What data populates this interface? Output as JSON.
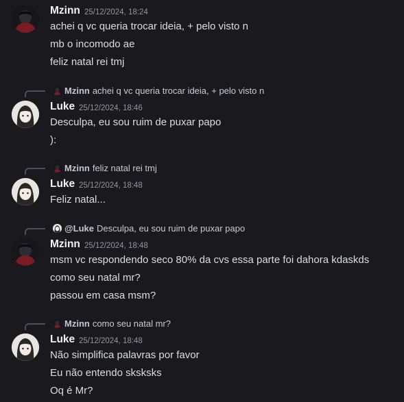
{
  "messages": [
    {
      "author": "Mzinn",
      "timestamp": "25/12/2024, 18:24",
      "lines": [
        "achei q vc queria trocar ideia, + pelo visto n",
        "mb o incomodo ae",
        "feliz natal rei tmj"
      ]
    },
    {
      "reply": {
        "author": "Mzinn",
        "text": "achei q vc queria trocar ideia, + pelo visto n"
      },
      "author": "Luke",
      "timestamp": "25/12/2024, 18:46",
      "lines": [
        "Desculpa, eu sou ruim de puxar papo",
        "):"
      ]
    },
    {
      "reply": {
        "author": "Mzinn",
        "text": "feliz natal rei tmj"
      },
      "author": "Luke",
      "timestamp": "25/12/2024, 18:48",
      "lines": [
        "Feliz natal..."
      ]
    },
    {
      "reply": {
        "author": "@Luke",
        "text": "Desculpa, eu sou ruim de puxar papo"
      },
      "author": "Mzinn",
      "timestamp": "25/12/2024, 18:48",
      "lines": [
        "msm vc respondendo seco 80% da cvs essa parte foi dahora kdaskds",
        "como seu natal mr?",
        "passou em casa msm?"
      ]
    },
    {
      "reply": {
        "author": "Mzinn",
        "text": "como seu natal mr?"
      },
      "author": "Luke",
      "timestamp": "25/12/2024, 18:48",
      "lines": [
        "Não simplifica palavras por favor",
        "Eu não entendo sksksks",
        "Oq é Mr?"
      ]
    }
  ]
}
